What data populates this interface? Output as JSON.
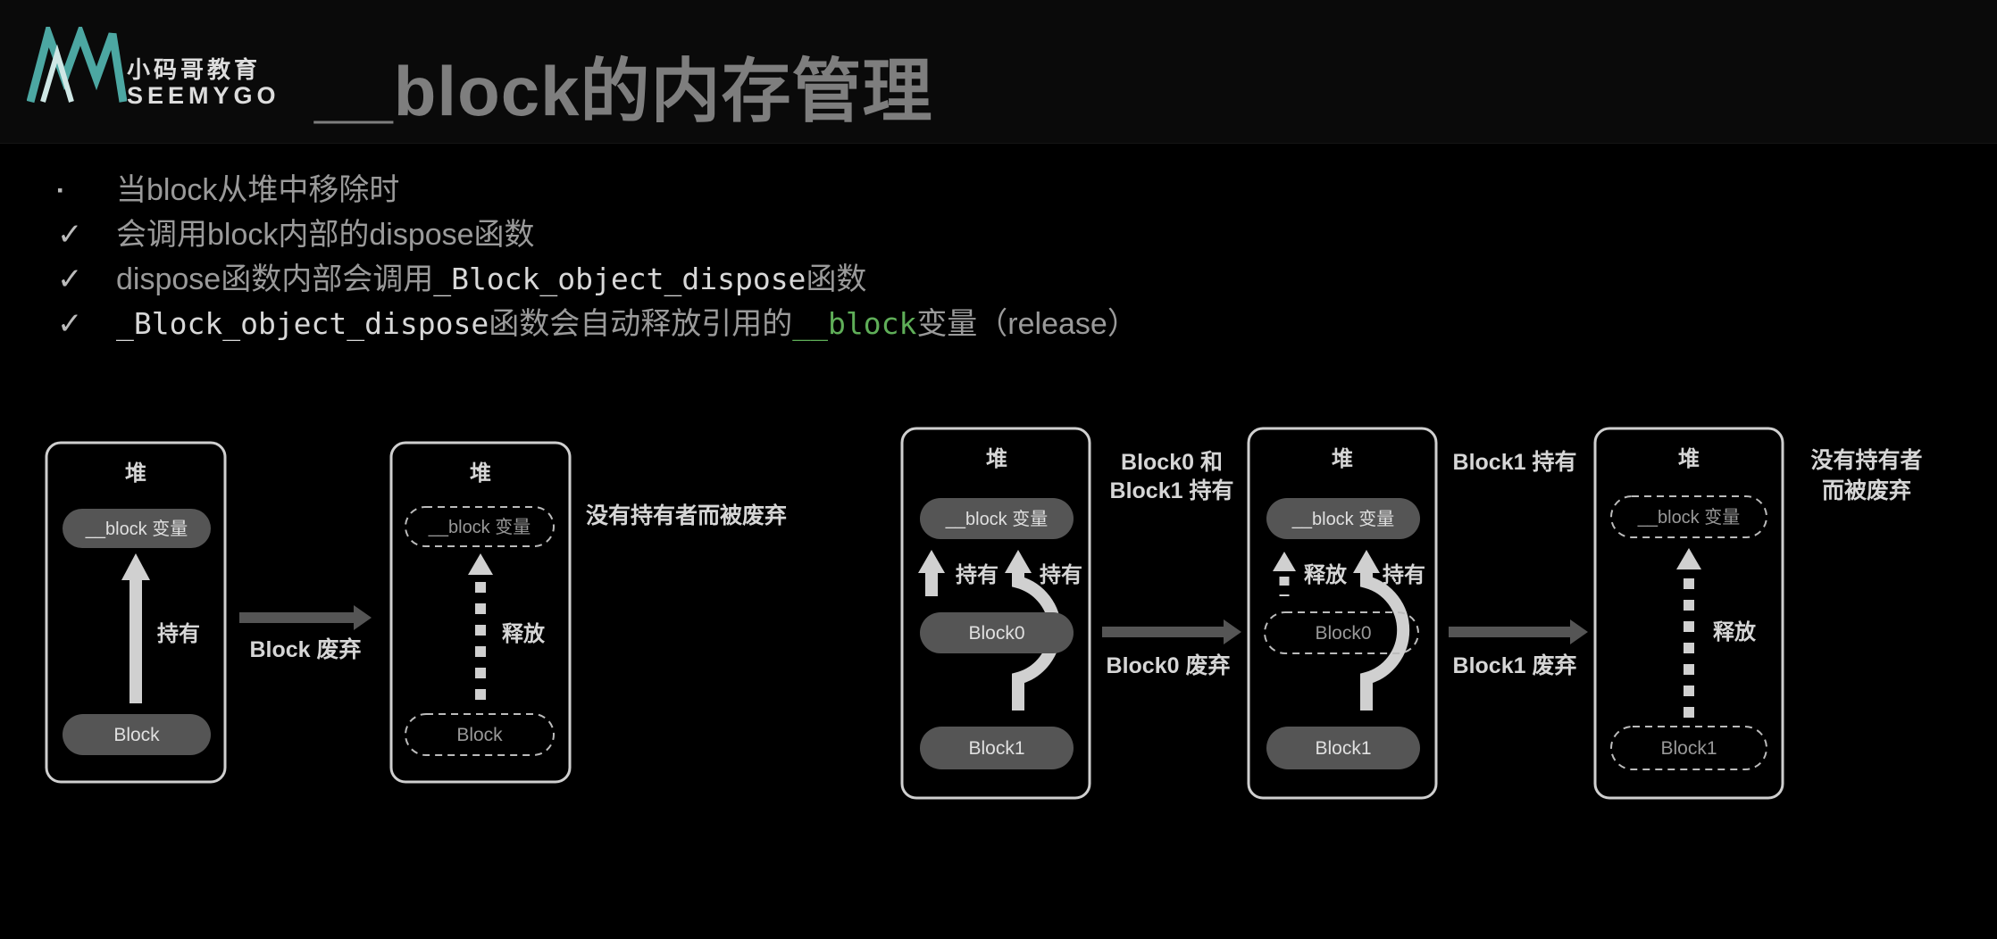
{
  "header": {
    "logo": {
      "cn": "小码哥教育",
      "en": "SEEMYGO"
    },
    "title": "__block的内存管理"
  },
  "bullets": [
    {
      "mark": "▪",
      "text": "当block从堆中移除时"
    },
    {
      "mark": "✓",
      "text": "会调用block内部的dispose函数"
    },
    {
      "mark": "✓",
      "text_a": "dispose函数内部会调用",
      "code": "_Block_object_dispose",
      "text_b": "函数"
    },
    {
      "mark": "✓",
      "code": "_Block_object_dispose",
      "text_a": "函数会自动释放引用的",
      "code_green": "__block",
      "text_b": "变量（release）"
    }
  ],
  "diagram1": {
    "heap_label": "堆",
    "var_label": "__block 变量",
    "hold_label": "持有",
    "block_label": "Block",
    "arrow_label": "Block 废弃",
    "release_label": "释放",
    "discard_note": "没有持有者而被废弃"
  },
  "diagram2": {
    "heap_label": "堆",
    "var_label": "__block 变量",
    "block0_label": "Block0",
    "block1_label": "Block1",
    "hold_label": "持有",
    "release_label": "释放",
    "note1_line1": "Block0 和",
    "note1_line2": "Block1 持有",
    "note2": "Block1 持有",
    "arrow1_label": "Block0 废弃",
    "arrow2_label": "Block1 废弃",
    "discard_line1": "没有持有者",
    "discard_line2": "而被废弃"
  },
  "colors": {
    "background": "#000000",
    "title": "#7e7e7e",
    "accent_green": "#5fae58",
    "logo_teal": "#4ca7a2"
  }
}
